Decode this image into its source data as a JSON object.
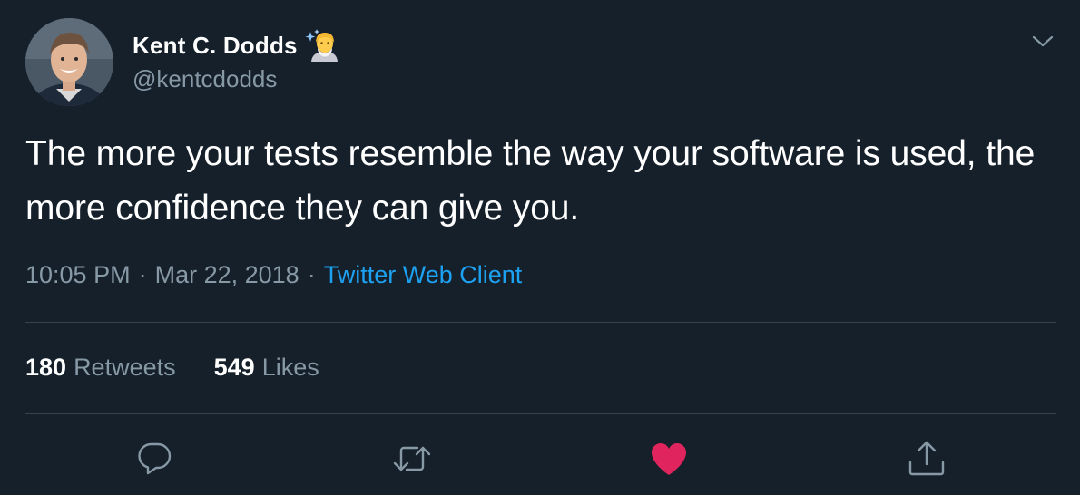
{
  "author": {
    "display_name": "Kent C. Dodds",
    "handle": "@kentcdodds",
    "name_emoji_icon": "mage-emoji-icon"
  },
  "tweet": {
    "text": "The more your tests resemble the way your software is used, the more confidence they can give you."
  },
  "meta": {
    "time": "10:05 PM",
    "separator": "·",
    "date": "Mar 22, 2018",
    "client": "Twitter Web Client"
  },
  "stats": {
    "retweets_count": "180",
    "retweets_label": "Retweets",
    "likes_count": "549",
    "likes_label": "Likes"
  },
  "actions": {
    "reply_icon": "reply-icon",
    "retweet_icon": "retweet-icon",
    "like_icon": "heart-icon",
    "share_icon": "share-icon"
  },
  "colors": {
    "background": "#15202b",
    "secondary_text": "#8899a6",
    "link": "#1da1f2",
    "divider": "#38444d",
    "like_active": "#e0245e"
  }
}
